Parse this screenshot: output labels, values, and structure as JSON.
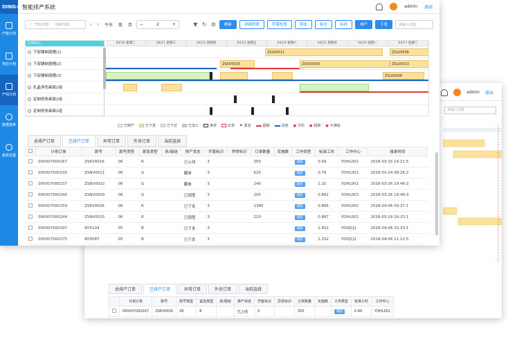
{
  "app": {
    "logo": "DING+",
    "title": "智能排产系统",
    "user": "admin",
    "logout": "退出"
  },
  "sidebar": {
    "items": [
      {
        "label": "产能计划"
      },
      {
        "label": "供应计划"
      },
      {
        "label": "产线计划"
      },
      {
        "label": "数据报表"
      },
      {
        "label": "系统设置"
      }
    ]
  },
  "toolbar": {
    "date_start_placeholder": "开始日期",
    "date_end_placeholder": "结束日期",
    "today": "今天",
    "week": "周",
    "month": "月",
    "stepper_value": "2",
    "buttons": [
      "刷新",
      "详细列表",
      "齐套检查",
      "导出",
      "拆分",
      "合并",
      "排产",
      "下发"
    ],
    "search_placeholder": "请输入内容"
  },
  "gantt": {
    "resource_header": "工作中心",
    "resources": [
      "下部铺制熔槽(1)",
      "下部铺制熔槽(2)",
      "下部铺制熔槽(3)",
      "轧晶净色画面1组",
      "定制修条画面1组",
      "定制修条画面1组"
    ],
    "dates": [
      "04/10 星期二",
      "04/11 星期三",
      "04/12 星期四",
      "04/13 星期五",
      "04/14 星期六",
      "04/15 星期日",
      "04/16 星期一",
      "04/17 星期二"
    ],
    "bars": [
      "ZSLV0011",
      "ZSLV0008",
      "ZSKV0016",
      "ZSKV0008",
      "ZSLV0013",
      "ZSLV0008"
    ]
  },
  "legend": [
    "已制产",
    "已下发",
    "已下达",
    "已加工",
    "换单",
    "红单",
    "紧急",
    "超期",
    "进度",
    "欠料",
    "超链",
    "不满班"
  ],
  "tabs": [
    "总排产订单",
    "已排产订单",
    "异常订单",
    "外协订单",
    "当前选择"
  ],
  "orders": {
    "columns": [
      "计划订单",
      "款号",
      "款号类型",
      "紧急类型",
      "拆/裂结",
      "排产状态",
      "齐套标识",
      "异常标识",
      "订单数量",
      "实施数",
      "工作类型",
      "标准工时",
      "工作中心",
      "接单时间"
    ],
    "rows": [
      [
        "000007000167",
        "ZSKV0016",
        "06",
        "R",
        "",
        "已上线",
        "3",
        "",
        "350",
        "",
        "裁剪",
        "0.99",
        "YDHL002",
        "2018-03-15 14:21:5"
      ],
      [
        "000007000235",
        "ZSNV0011",
        "06",
        "G",
        "",
        "翻单",
        "3",
        "",
        "620",
        "",
        "裁剪",
        "0.79",
        "YDHL001",
        "2018-03-24 08:26:2"
      ],
      [
        "000007000237",
        "ZSNV0022",
        "06",
        "G",
        "",
        "翻单",
        "3",
        "",
        "240",
        "",
        "裁剪",
        "1.15",
        "YDHL001",
        "2018-03-26 19:46:3"
      ],
      [
        "000007000240",
        "ZSNV0009",
        "06",
        "G",
        "",
        "已调度",
        "3",
        "",
        "205",
        "",
        "裁剪",
        "0.862",
        "YDHL003",
        "2018-03-26 19:46:3"
      ],
      [
        "000007000259",
        "ZSKV0026",
        "06",
        "R",
        "",
        "已下发",
        "3",
        "",
        "1380",
        "",
        "裁剪",
        "0.885",
        "YDHL002",
        "2018-04-06 09:37:1"
      ],
      [
        "000007000244",
        "ZSNV0015",
        "06",
        "R",
        "",
        "已调度",
        "3",
        "",
        "210",
        "",
        "裁剪",
        "0.887",
        "YDHL002",
        "2018-03-29 16:23:1"
      ],
      [
        "000007000297",
        "NY5104",
        "05",
        "B",
        "",
        "已下发",
        "3",
        "",
        "",
        "",
        "裁剪",
        "1.452",
        "YDDJCJ1",
        "2018-04-06 10:33:1"
      ],
      [
        "000007000275",
        "NY0087",
        "05",
        "B",
        "",
        "已下发",
        "3",
        "",
        "",
        "",
        "裁剪",
        "1.152",
        "YDDJCJ1",
        "2018-04-06 11:12:5"
      ]
    ]
  },
  "back": {
    "search_placeholder": "请输入内容",
    "row": [
      "000007000167",
      "ZSKV0016",
      "06",
      "R",
      "",
      "已上线",
      "3",
      "",
      "350",
      "",
      "裁剪",
      "0.99",
      "YDHL002",
      "2018-03-15 14:21:5"
    ]
  }
}
